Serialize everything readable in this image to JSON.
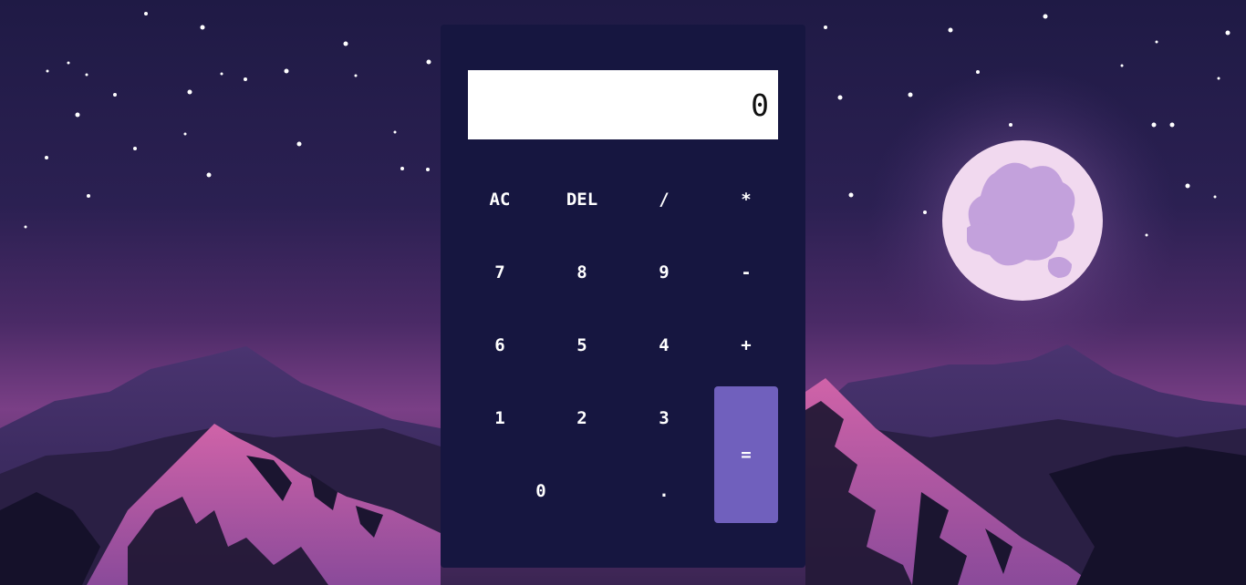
{
  "display": {
    "value": "0"
  },
  "keys": {
    "ac": "AC",
    "del": "DEL",
    "divide": "/",
    "multiply": "*",
    "seven": "7",
    "eight": "8",
    "nine": "9",
    "minus": "-",
    "six": "6",
    "five": "5",
    "four": "4",
    "plus": "+",
    "one": "1",
    "two": "2",
    "three": "3",
    "equals": "=",
    "zero": "0",
    "dot": "."
  },
  "colors": {
    "panel": "#161640",
    "display_bg": "#ffffff",
    "equals_bg": "#7060bd",
    "key_text": "#ffffff"
  }
}
